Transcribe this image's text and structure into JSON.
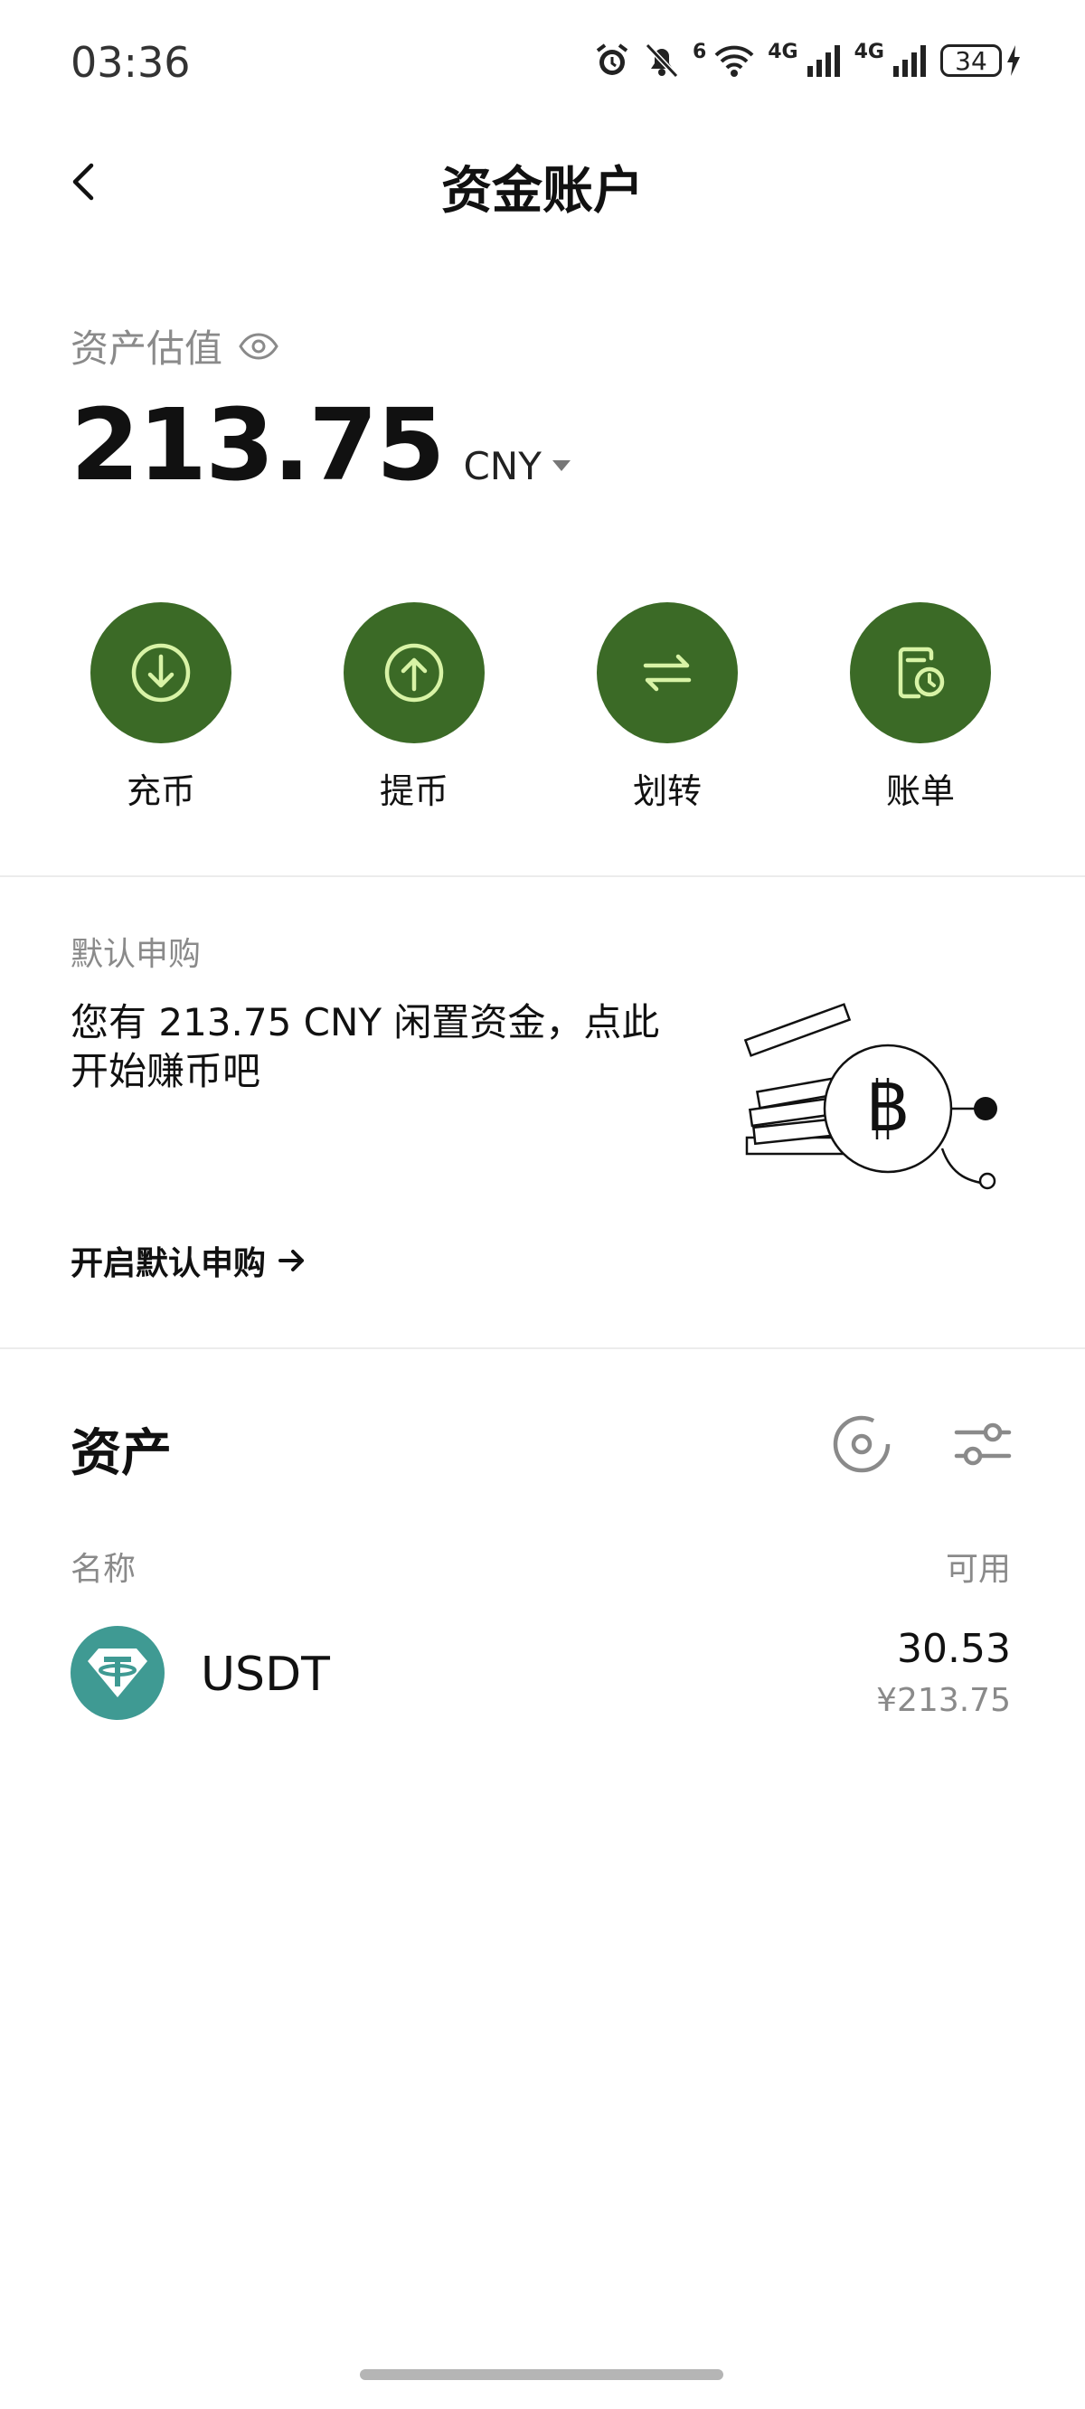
{
  "status_bar": {
    "time": "03:36",
    "wifi_badge": "6",
    "net1": "4G",
    "net2": "4G",
    "battery": "34",
    "icons": [
      "alarm-icon",
      "mute-bell-icon",
      "wifi-icon",
      "signal-icon",
      "signal-icon",
      "battery-icon",
      "charging-icon"
    ]
  },
  "header": {
    "title": "资金账户",
    "back_icon": "chevron-left-icon"
  },
  "estimate": {
    "label": "资产估值",
    "amount": "213.75",
    "currency": "CNY"
  },
  "actions": [
    {
      "label": "充币",
      "icon": "deposit-icon"
    },
    {
      "label": "提币",
      "icon": "withdraw-icon"
    },
    {
      "label": "划转",
      "icon": "transfer-icon"
    },
    {
      "label": "账单",
      "icon": "bill-icon"
    }
  ],
  "promo": {
    "kicker": "默认申购",
    "text": "您有 213.75 CNY 闲置资金，点此开始赚币吧",
    "link": "开启默认申购"
  },
  "assets": {
    "title": "资产",
    "col_name": "名称",
    "col_available": "可用",
    "rows": [
      {
        "name": "USDT",
        "amount": "30.53",
        "value": "¥213.75"
      }
    ]
  },
  "colors": {
    "accent_green": "#3b6a26",
    "icon_lime": "#d8f3a6",
    "usdt_teal": "#3f9a93"
  }
}
